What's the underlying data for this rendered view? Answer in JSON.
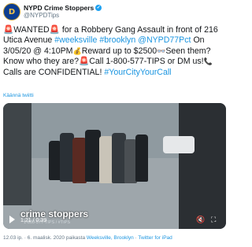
{
  "account": {
    "display_name": "NYPD Crime Stoppers",
    "handle": "@NYPDTips",
    "avatar_letter": "D"
  },
  "tweet": {
    "seg1": "WANTED",
    "seg2": "for a Robbery Gang Assault in front of 216 Utica Avenue",
    "tag1": "#weeksville",
    "tag2": "#brooklyn",
    "tag3": "@NYPD77Pct",
    "seg3": "On 3/05/20 @ 4:10PM",
    "seg4": "Reward up to $2500",
    "seg5": "Seen them? Know who they are?",
    "seg6": "Call 1-800-577-TIPS or DM us!",
    "seg7": "Calls are CONFIDENTIAL!",
    "tag4": "#YourCityYourCall"
  },
  "translate_label": "Käännä twiitti",
  "video": {
    "watermark": "crime stoppers",
    "watermark_sub": "1-800-577-TIPS / #TIPS",
    "time": "1:21 / 0:39"
  },
  "footer": {
    "time_date": "12.03 ip. · 6. maalisk. 2020 paikasta",
    "location": "Weeksville, Brooklyn",
    "sep": " · ",
    "client": "Twitter for iPad"
  }
}
